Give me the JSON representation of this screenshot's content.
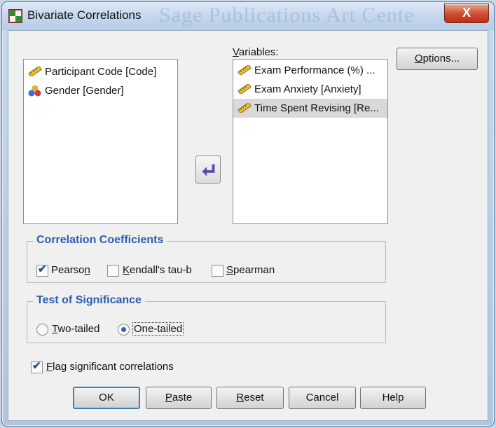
{
  "window": {
    "title": "Bivariate Correlations",
    "watermark": "Sage Publications Art Cente",
    "close_glyph": "X"
  },
  "source_list": {
    "items": [
      {
        "label": "Participant Code [Code]",
        "icon": "scale-ruler-icon"
      },
      {
        "label": "Gender [Gender]",
        "icon": "nominal-balls-icon"
      }
    ]
  },
  "variables": {
    "label_prefix": "",
    "label_underlined": "V",
    "label_rest": "ariables:",
    "items": [
      {
        "label": "Exam Performance (%) ...",
        "icon": "scale-ruler-icon",
        "selected": false
      },
      {
        "label": "Exam Anxiety [Anxiety]",
        "icon": "scale-ruler-icon",
        "selected": false
      },
      {
        "label": "Time Spent Revising [Re...",
        "icon": "scale-ruler-icon",
        "selected": true
      }
    ]
  },
  "options_button": {
    "u": "O",
    "rest": "ptions..."
  },
  "move_button": {
    "icon": "move-arrow-icon"
  },
  "coefficients": {
    "title": "Correlation Coefficients",
    "pearson": {
      "pre": "Pearso",
      "u": "n",
      "post": "",
      "checked": true
    },
    "kendall": {
      "pre": "",
      "u": "K",
      "post": "endall's tau-b",
      "checked": false
    },
    "spearman": {
      "pre": "",
      "u": "S",
      "post": "pearman",
      "checked": false
    }
  },
  "significance": {
    "title": "Test of Significance",
    "two_tailed": {
      "u": "T",
      "rest": "wo-tailed",
      "selected": false
    },
    "one_tailed": {
      "label": "One-tailed",
      "selected": true
    }
  },
  "flag": {
    "u": "F",
    "rest": "lag significant correlations",
    "checked": true
  },
  "buttons": {
    "ok": "OK",
    "paste": {
      "u": "P",
      "rest": "aste"
    },
    "reset": {
      "u": "R",
      "rest": "eset"
    },
    "cancel": "Cancel",
    "help": "Help"
  },
  "colors": {
    "group_title": "#2a5db0",
    "check": "#1f4b9e",
    "arrow": "#5b4bb0",
    "title_bar": "#c1d4ec",
    "close": "#cf4a2f"
  }
}
